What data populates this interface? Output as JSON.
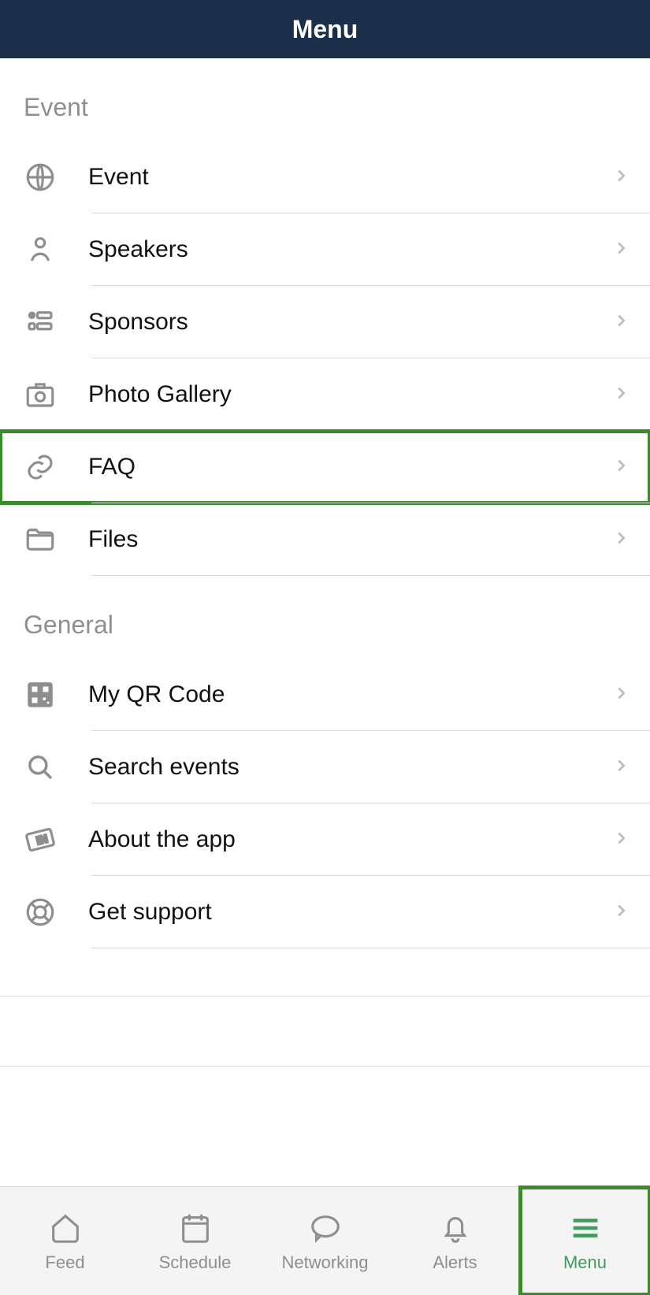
{
  "header": {
    "title": "Menu"
  },
  "sections": {
    "event": {
      "title": "Event",
      "items": [
        {
          "label": "Event"
        },
        {
          "label": "Speakers"
        },
        {
          "label": "Sponsors"
        },
        {
          "label": "Photo Gallery"
        },
        {
          "label": "FAQ"
        },
        {
          "label": "Files"
        }
      ]
    },
    "general": {
      "title": "General",
      "items": [
        {
          "label": "My QR Code"
        },
        {
          "label": "Search events"
        },
        {
          "label": "About the app"
        },
        {
          "label": "Get support"
        }
      ]
    }
  },
  "tabs": {
    "feed": "Feed",
    "schedule": "Schedule",
    "networking": "Networking",
    "alerts": "Alerts",
    "menu": "Menu"
  },
  "highlight": {
    "menu_item_index": 4,
    "active_tab": "menu"
  }
}
